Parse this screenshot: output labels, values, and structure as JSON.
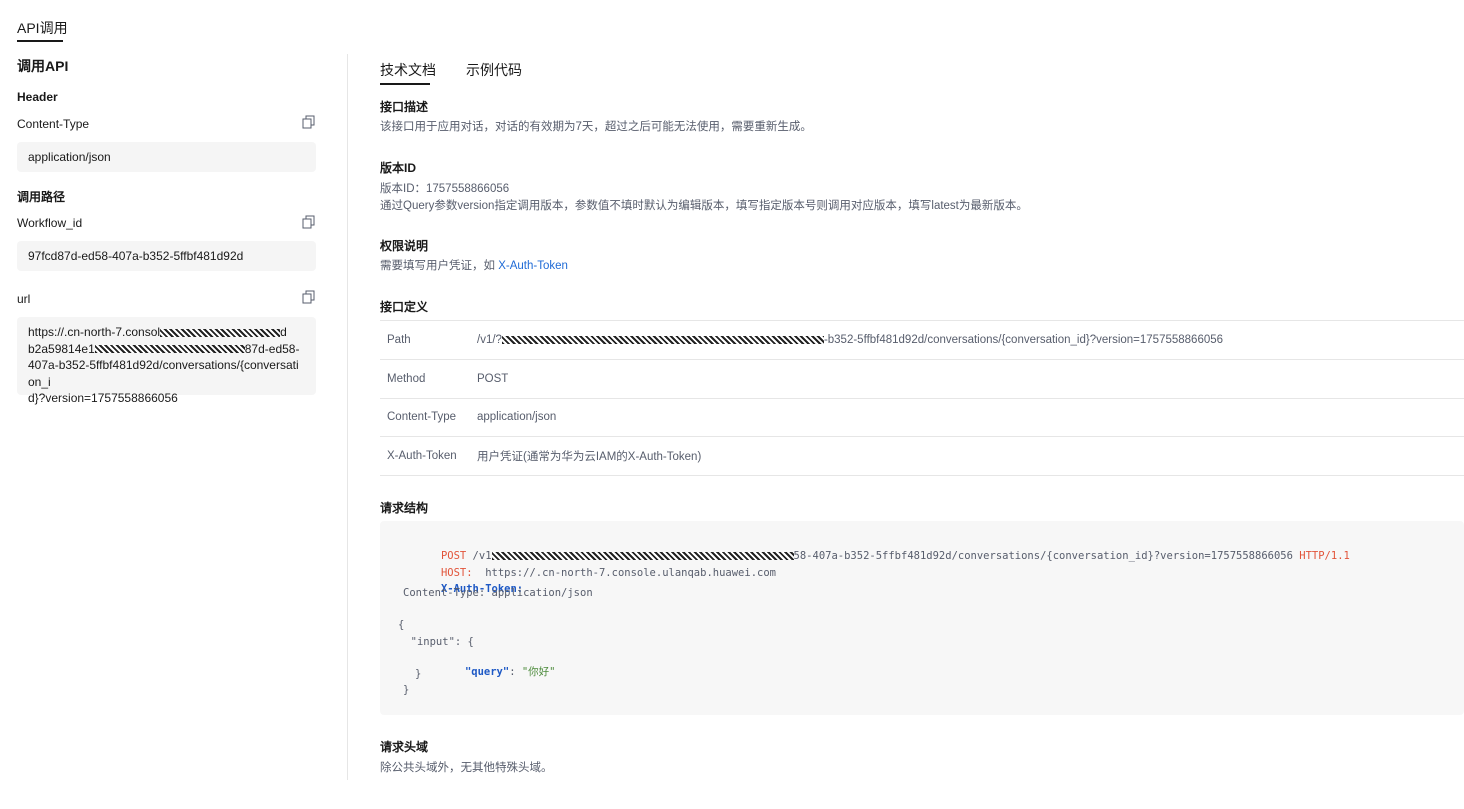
{
  "page": {
    "top_tab": "API调用"
  },
  "left": {
    "title": "调用API",
    "header_section": "Header",
    "content_type_label": "Content-Type",
    "content_type_value": "application/json",
    "path_section": "调用路径",
    "workflow_label": "Workflow_id",
    "workflow_value": "97fcd87d-ed58-407a-b352-5ffbf481d92d",
    "url_label": "url",
    "url_line1_prefix": "https://.cn-north-7.consol",
    "url_line1_suffix": "d",
    "url_line2_prefix": "b2a59814e1",
    "url_line2_suffix": "87d-ed58-",
    "url_line3": "407a-b352-5ffbf481d92d/conversations/{conversation_i",
    "url_line4": "d}?version=1757558866056"
  },
  "right": {
    "tabs": [
      "技术文档",
      "示例代码"
    ],
    "desc_title": "接口描述",
    "desc_text": "该接口用于应用对话，对话的有效期为7天，超过之后可能无法使用，需要重新生成。",
    "version_title": "版本ID",
    "version_line1": "版本ID：1757558866056",
    "version_line2": "通过Query参数version指定调用版本，参数值不填时默认为编辑版本，填写指定版本号则调用对应版本，填写latest为最新版本。",
    "auth_title": "权限说明",
    "auth_text": "需要填写用户凭证，如",
    "auth_link": "X-Auth-Token",
    "def_title": "接口定义",
    "def_rows": [
      {
        "key": "Path",
        "prefix": "/v1/?",
        "suffix": "-b352-5ffbf481d92d/conversations/{conversation_id}?version=1757558866056"
      },
      {
        "key": "Method",
        "value": "POST"
      },
      {
        "key": "Content-Type",
        "value": "application/json"
      },
      {
        "key": "X-Auth-Token",
        "value": "用户凭证(通常为华为云IAM的X-Auth-Token)"
      }
    ],
    "req_title": "请求结构",
    "code": {
      "post_kw": "POST",
      "post_path_prefix": " /v1",
      "post_path_suffix": "58-407a-b352-5ffbf481d92d/conversations/{conversation_id}?version=1757558866056 ",
      "http_ver": "HTTP/1.1",
      "host_kw": "HOST:",
      "host_val": "  https://.cn-north-7.console.ulanqab.huawei.com",
      "auth_kw": "X-Auth-Token:",
      "ct_line": "Content-Type: application/json",
      "brace_open": "{",
      "input_line": "  \"input\": {",
      "query_key": "\"query\"",
      "query_colon": ": ",
      "query_val": "\"你好\"",
      "inner_close": "}",
      "brace_close": "}"
    },
    "reqhead_title": "请求头域",
    "reqhead_text": "除公共头域外，无其他特殊头域。"
  }
}
